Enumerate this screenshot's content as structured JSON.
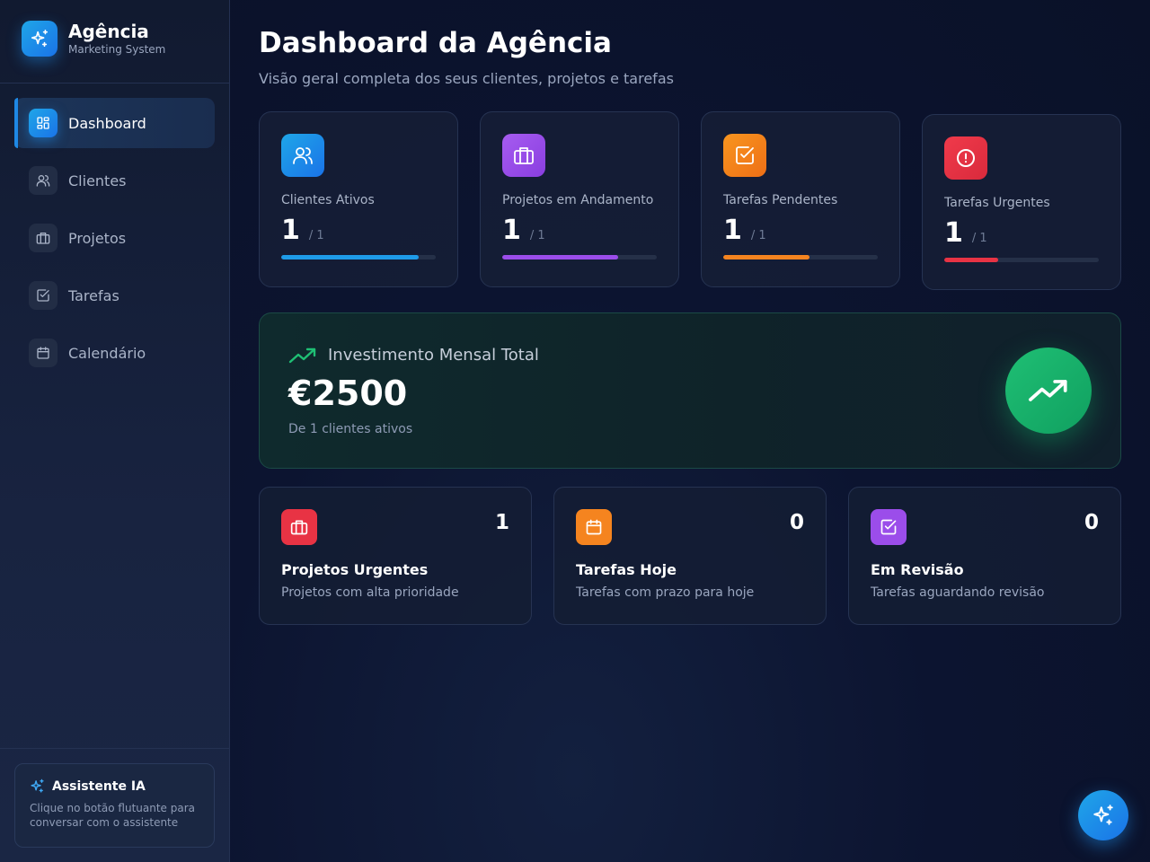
{
  "brand": {
    "title": "Agência",
    "subtitle": "Marketing System"
  },
  "nav": [
    {
      "label": "Dashboard",
      "icon": "dashboard-icon",
      "active": true
    },
    {
      "label": "Clientes",
      "icon": "users-icon",
      "active": false
    },
    {
      "label": "Projetos",
      "icon": "briefcase-icon",
      "active": false
    },
    {
      "label": "Tarefas",
      "icon": "checkbox-icon",
      "active": false
    },
    {
      "label": "Calendário",
      "icon": "calendar-icon",
      "active": false
    }
  ],
  "assistant": {
    "title": "Assistente IA",
    "description": "Clique no botão flutuante para conversar com o assistente",
    "icon": "sparkles-icon"
  },
  "page": {
    "title": "Dashboard da Agência",
    "subtitle": "Visão geral completa dos seus clientes, projetos e tarefas"
  },
  "stats": [
    {
      "label": "Clientes Ativos",
      "value": "1",
      "total": "/ 1",
      "icon": "users-icon",
      "color": "#1e9be8",
      "progress": 0.89
    },
    {
      "label": "Projetos em Andamento",
      "value": "1",
      "total": "/ 1",
      "icon": "briefcase-icon",
      "color": "#9b4dea",
      "progress": 0.75
    },
    {
      "label": "Tarefas Pendentes",
      "value": "1",
      "total": "/ 1",
      "icon": "checkbox-icon",
      "color": "#f5841f",
      "progress": 0.56
    },
    {
      "label": "Tarefas Urgentes",
      "value": "1",
      "total": "/ 1",
      "icon": "alert-circle-icon",
      "color": "#e83344",
      "progress": 0.35
    }
  ],
  "investment": {
    "label": "Investimento Mensal Total",
    "value": "€2500",
    "subtitle": "De 1 clientes ativos",
    "icon": "trending-up-icon",
    "color": "#1fbf74"
  },
  "summaries": [
    {
      "title": "Projetos Urgentes",
      "description": "Projetos com alta prioridade",
      "count": "1",
      "icon": "briefcase-icon",
      "color": "#e83344"
    },
    {
      "title": "Tarefas Hoje",
      "description": "Tarefas com prazo para hoje",
      "count": "0",
      "icon": "calendar-icon",
      "color": "#f5841f"
    },
    {
      "title": "Em Revisão",
      "description": "Tarefas aguardando revisão",
      "count": "0",
      "icon": "checkbox-icon",
      "color": "#9b4dea"
    }
  ],
  "fab": {
    "icon": "sparkles-icon"
  }
}
